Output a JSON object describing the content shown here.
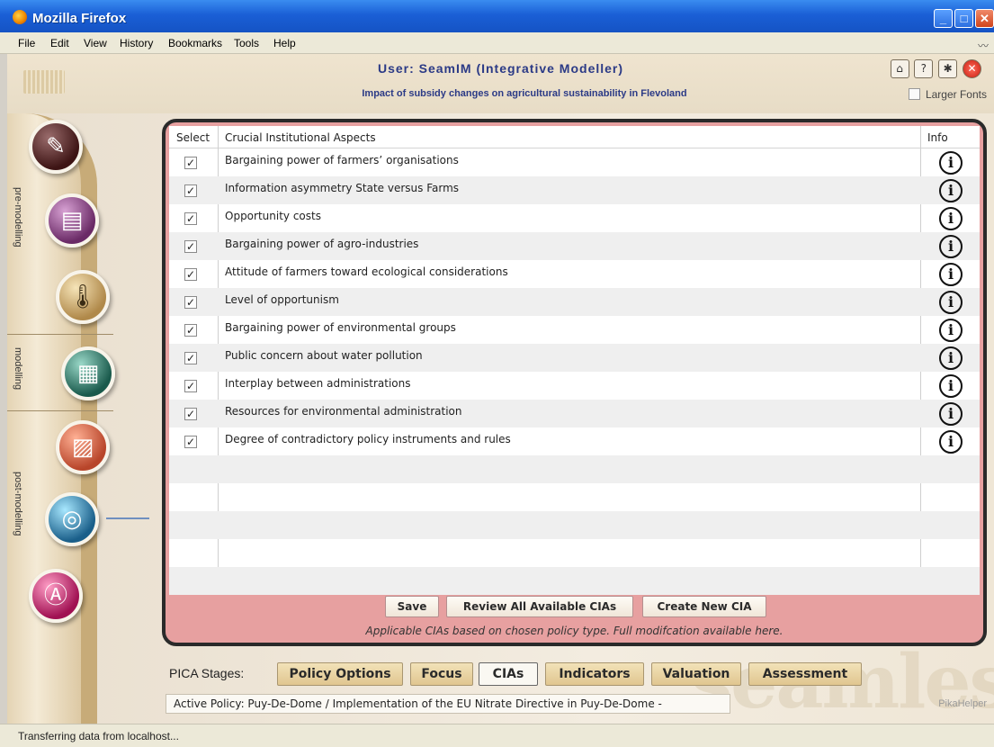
{
  "window": {
    "title": "Mozilla Firefox"
  },
  "menu": [
    {
      "label": "File"
    },
    {
      "label": "Edit"
    },
    {
      "label": "View"
    },
    {
      "label": "History"
    },
    {
      "label": "Bookmarks"
    },
    {
      "label": "Tools"
    },
    {
      "label": "Help"
    }
  ],
  "header": {
    "user_title": "User: SeamIM (Integrative Modeller)",
    "subtitle": "Impact of subsidy changes on agricultural sustainability in Flevoland",
    "larger_fonts_label": "Larger Fonts",
    "icons": [
      "home-icon",
      "help-icon",
      "bug-icon",
      "close-icon"
    ]
  },
  "sidebar": {
    "sections": [
      {
        "label": "pre-modelling"
      },
      {
        "label": "modelling"
      },
      {
        "label": "post-modelling"
      }
    ],
    "buttons": [
      {
        "icon": "clipboard-icon"
      },
      {
        "icon": "document-icon"
      },
      {
        "icon": "thermometer-icon"
      },
      {
        "icon": "calculator-icon"
      },
      {
        "icon": "chart-icon"
      },
      {
        "icon": "magnifier-icon"
      },
      {
        "icon": "analysis-icon"
      }
    ]
  },
  "table": {
    "headers": {
      "select": "Select",
      "aspect": "Crucial Institutional Aspects",
      "info": "Info"
    },
    "rows": [
      {
        "checked": true,
        "label": "Bargaining power of farmers’ organisations"
      },
      {
        "checked": true,
        "label": "Information asymmetry State versus Farms"
      },
      {
        "checked": true,
        "label": "Opportunity costs"
      },
      {
        "checked": true,
        "label": "Bargaining power of agro-industries"
      },
      {
        "checked": true,
        "label": "Attitude of farmers toward ecological considerations"
      },
      {
        "checked": true,
        "label": "Level of opportunism"
      },
      {
        "checked": true,
        "label": "Bargaining power of environmental groups"
      },
      {
        "checked": true,
        "label": "Public concern about water pollution"
      },
      {
        "checked": true,
        "label": "Interplay between administrations"
      },
      {
        "checked": true,
        "label": "Resources for environmental administration"
      },
      {
        "checked": true,
        "label": "Degree of contradictory policy instruments and rules"
      }
    ],
    "check_glyph": "✓",
    "info_glyph": "i"
  },
  "actions": {
    "save": "Save",
    "review": "Review All Available CIAs",
    "create": "Create New CIA",
    "note": "Applicable CIAs based on chosen policy type. Full modifcation available here."
  },
  "stages": {
    "label": "PICA Stages:",
    "items": [
      {
        "label": "Policy Options"
      },
      {
        "label": "Focus"
      },
      {
        "label": "CIAs",
        "current": true
      },
      {
        "label": "Indicators"
      },
      {
        "label": "Valuation"
      },
      {
        "label": "Assessment"
      }
    ]
  },
  "active_policy": "Active Policy: Puy-De-Dome / Implementation of the EU Nitrate Directive in Puy-De-Dome -",
  "helper": "PikaHelper",
  "status": "Transferring data from localhost..."
}
